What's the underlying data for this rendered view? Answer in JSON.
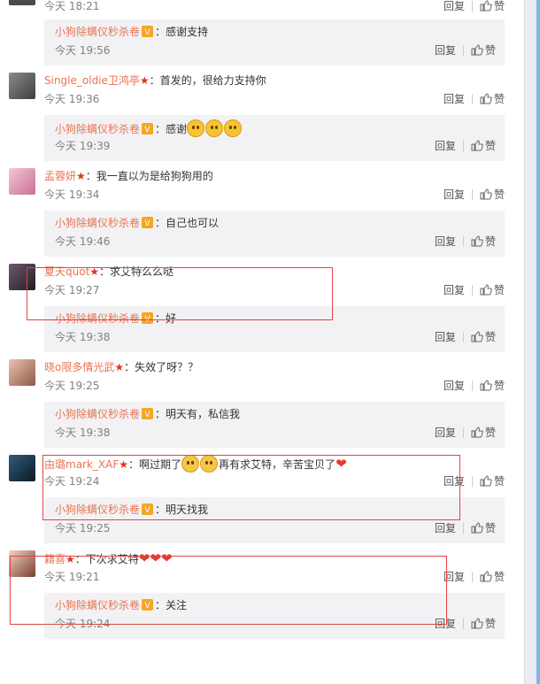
{
  "actions": {
    "reply": "回复",
    "like": "赞"
  },
  "top": {
    "time": "今天 18:21"
  },
  "items": [
    {
      "reply": {
        "name": "小狗除螨仪秒杀卷",
        "text": "：感谢支持",
        "time": "今天 19:56"
      }
    },
    {
      "comment": {
        "name": "Single_oldie卫鸿亭",
        "text": "：首发的，很给力支持你",
        "time": "今天 19:36"
      },
      "reply": {
        "name": "小狗除螨仪秒杀卷",
        "text": "：感谢",
        "time": "今天 19:39"
      }
    },
    {
      "comment": {
        "name": "孟蓉妍",
        "text": "：我一直以为是给狗狗用的",
        "time": "今天 19:34"
      },
      "reply": {
        "name": "小狗除螨仪秒杀卷",
        "text": "：自己也可以",
        "time": "今天 19:46"
      }
    },
    {
      "comment": {
        "name": "夏天quot",
        "text": "：求艾特么么哒",
        "time": "今天 19:27"
      },
      "reply": {
        "name": "小狗除螨仪秒杀卷",
        "text": "：好",
        "time": "今天 19:38"
      }
    },
    {
      "comment": {
        "name": "晓o限多情光武",
        "text": "：失效了呀？？",
        "time": "今天 19:25"
      },
      "reply": {
        "name": "小狗除螨仪秒杀卷",
        "text": "：明天有，私信我",
        "time": "今天 19:38"
      }
    },
    {
      "comment": {
        "name": "由璐mark_XAF",
        "text": "：啊过期了",
        "text2": "再有求艾特，辛苦宝贝了",
        "time": "今天 19:24"
      },
      "reply": {
        "name": "小狗除螨仪秒杀卷",
        "text": "：明天找我",
        "time": "今天 19:25"
      }
    },
    {
      "comment": {
        "name": "籍喜",
        "text": "：下次求艾特",
        "time": "今天 19:21"
      },
      "reply": {
        "name": "小狗除螨仪秒杀卷",
        "text": "：关注",
        "time": "今天 19:24"
      }
    }
  ],
  "colors": {
    "name": "#eb7350",
    "highlight_box": "#e04444",
    "reply_bg": "#f2f2f5"
  }
}
